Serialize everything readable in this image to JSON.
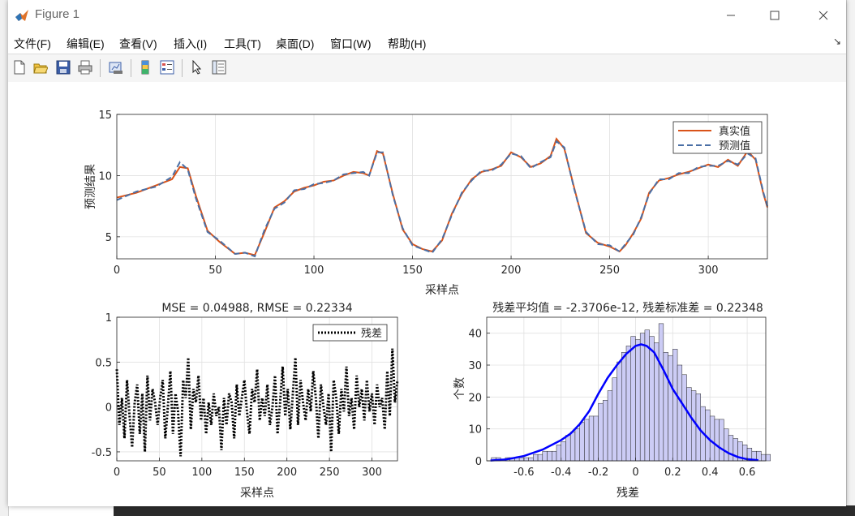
{
  "window": {
    "title": "Figure 1"
  },
  "menu": [
    "文件(F)",
    "编辑(E)",
    "查看(V)",
    "插入(I)",
    "工具(T)",
    "桌面(D)",
    "窗口(W)",
    "帮助(H)"
  ],
  "toolbar_icons": [
    "new-figure-icon",
    "open-file-icon",
    "save-icon",
    "print-icon",
    "link-plot-icon",
    "insert-colorbar-icon",
    "insert-legend-icon",
    "edit-plot-cursor-icon",
    "property-inspector-icon"
  ],
  "colors": {
    "actual": "#d95319",
    "predicted": "#4a6fa5",
    "residual": "#000000",
    "hist_fill": "#ccccf5",
    "kde": "#0000ff",
    "grid": "#e1e1e1"
  },
  "chart_data": [
    {
      "type": "line",
      "ylabel": "预测结果",
      "xlabel": "采样点",
      "xlim": [
        0,
        330
      ],
      "ylim": [
        3.2,
        15
      ],
      "xticks": [
        0,
        50,
        100,
        150,
        200,
        250,
        300
      ],
      "yticks": [
        5,
        10,
        15
      ],
      "grid": true,
      "legend_position": "top-right",
      "legend": [
        "真实值",
        "预测值"
      ],
      "series": [
        {
          "name": "真实值",
          "style": "solid"
        },
        {
          "name": "预测值",
          "style": "dashed"
        }
      ],
      "x": [
        0,
        10,
        20,
        28,
        32,
        36,
        40,
        46,
        52,
        60,
        65,
        70,
        75,
        80,
        85,
        90,
        95,
        100,
        105,
        110,
        115,
        120,
        125,
        128,
        132,
        135,
        140,
        145,
        150,
        155,
        160,
        165,
        170,
        175,
        180,
        185,
        190,
        195,
        200,
        205,
        210,
        215,
        220,
        223,
        227,
        232,
        238,
        244,
        250,
        255,
        258,
        262,
        266,
        270,
        275,
        280,
        285,
        290,
        295,
        300,
        305,
        310,
        315,
        320,
        324,
        328,
        330
      ],
      "values_actual": [
        8.2,
        8.6,
        9.2,
        9.7,
        10.7,
        10.6,
        8.4,
        5.5,
        4.6,
        3.6,
        3.7,
        3.5,
        5.4,
        7.4,
        7.9,
        8.7,
        9.0,
        9.2,
        9.5,
        9.6,
        10.0,
        10.3,
        10.2,
        10.0,
        12.0,
        11.8,
        8.5,
        5.6,
        4.4,
        4.0,
        3.8,
        4.7,
        6.9,
        8.5,
        9.7,
        10.3,
        10.5,
        10.8,
        11.9,
        11.5,
        10.7,
        11.0,
        11.6,
        13.0,
        12.2,
        9.0,
        5.3,
        4.5,
        4.2,
        3.8,
        4.3,
        5.3,
        6.5,
        8.6,
        9.6,
        9.8,
        10.1,
        10.3,
        10.6,
        10.9,
        10.7,
        11.3,
        10.8,
        12.0,
        11.3,
        8.5,
        7.4
      ],
      "values_predicted": [
        8.0,
        8.7,
        9.1,
        9.9,
        11.1,
        10.5,
        8.2,
        5.4,
        4.7,
        3.6,
        3.7,
        3.4,
        5.6,
        7.3,
        7.8,
        8.8,
        8.9,
        9.3,
        9.4,
        9.6,
        10.1,
        10.2,
        10.3,
        10.0,
        11.9,
        11.9,
        8.4,
        5.7,
        4.3,
        4.0,
        3.7,
        4.8,
        6.8,
        8.6,
        9.6,
        10.4,
        10.4,
        10.9,
        11.8,
        11.6,
        10.6,
        11.1,
        11.5,
        12.8,
        12.3,
        8.9,
        5.4,
        4.4,
        4.3,
        3.8,
        4.4,
        5.2,
        6.6,
        8.5,
        9.7,
        9.7,
        10.2,
        10.2,
        10.7,
        10.8,
        10.8,
        11.2,
        10.9,
        11.8,
        11.4,
        8.6,
        7.5
      ]
    },
    {
      "type": "line",
      "title": "MSE = 0.04988, RMSE = 0.22334",
      "xlabel": "采样点",
      "xlim": [
        0,
        330
      ],
      "ylim": [
        -0.6,
        1
      ],
      "xticks": [
        0,
        50,
        100,
        150,
        200,
        250,
        300
      ],
      "yticks": [
        -0.5,
        0,
        0.5,
        1
      ],
      "grid": true,
      "legend_position": "top-right",
      "series": [
        {
          "name": "残差",
          "style": "dotted"
        }
      ],
      "x": [
        0,
        3,
        6,
        9,
        12,
        15,
        18,
        21,
        24,
        27,
        30,
        33,
        36,
        39,
        42,
        45,
        48,
        51,
        54,
        57,
        60,
        63,
        66,
        69,
        72,
        75,
        78,
        81,
        84,
        87,
        90,
        93,
        96,
        99,
        102,
        105,
        108,
        111,
        114,
        117,
        120,
        123,
        126,
        129,
        132,
        135,
        138,
        141,
        144,
        147,
        150,
        153,
        156,
        159,
        162,
        165,
        168,
        171,
        174,
        177,
        180,
        183,
        186,
        189,
        192,
        195,
        198,
        201,
        204,
        207,
        210,
        213,
        216,
        219,
        222,
        225,
        228,
        231,
        234,
        237,
        240,
        243,
        246,
        249,
        252,
        255,
        258,
        261,
        264,
        267,
        270,
        273,
        276,
        279,
        282,
        285,
        288,
        291,
        294,
        297,
        300,
        303,
        306,
        309,
        312,
        315,
        318,
        321,
        324,
        327,
        330
      ],
      "values": [
        0.42,
        -0.2,
        0.1,
        -0.35,
        0.3,
        -0.1,
        -0.45,
        0.05,
        0.25,
        -0.3,
        0.15,
        -0.5,
        0.35,
        -0.15,
        0.2,
        0.05,
        -0.2,
        0.1,
        0.3,
        -0.35,
        0.0,
        0.4,
        -0.3,
        0.15,
        -0.05,
        -0.55,
        0.3,
        0.1,
        0.55,
        -0.25,
        0.2,
        0.05,
        0.35,
        -0.15,
        0.1,
        -0.3,
        0.05,
        -0.2,
        0.15,
        -0.1,
        0.0,
        -0.48,
        0.1,
        -0.2,
        0.15,
        0.05,
        -0.35,
        0.25,
        -0.1,
        0.1,
        0.3,
        -0.05,
        -0.3,
        0.2,
        0.05,
        0.42,
        -0.15,
        0.1,
        -0.1,
        0.25,
        -0.2,
        0.0,
        0.35,
        -0.3,
        0.05,
        0.45,
        -0.1,
        0.2,
        -0.25,
        0.15,
        0.55,
        -0.2,
        0.3,
        0.05,
        -0.15,
        0.2,
        -0.05,
        0.4,
        0.1,
        -0.35,
        0.25,
        0.0,
        -0.2,
        0.15,
        -0.5,
        0.3,
        0.1,
        -0.3,
        0.2,
        -0.05,
        0.45,
        -0.1,
        0.1,
        -0.25,
        0.35,
        0.0,
        0.2,
        -0.15,
        0.3,
        -0.05,
        0.15,
        -0.2,
        0.25,
        0.0,
        0.1,
        -0.25,
        0.4,
        -0.1,
        0.65,
        0.05,
        0.3
      ]
    },
    {
      "type": "bar",
      "title": "残差平均值 = -2.3706e-12, 残差标准差 = 0.22348",
      "xlabel": "残差",
      "ylabel": "个数",
      "xlim": [
        -0.8,
        0.7
      ],
      "ylim": [
        0,
        45
      ],
      "xticks": [
        -0.6,
        -0.4,
        -0.2,
        0,
        0.2,
        0.4,
        0.6
      ],
      "yticks": [
        0,
        10,
        20,
        30,
        40
      ],
      "grid": true,
      "bin_start": -0.775,
      "bin_width": 0.025,
      "values": [
        1,
        1,
        0,
        1,
        1,
        1,
        1,
        1,
        1,
        2,
        2,
        3,
        3,
        3,
        5,
        6,
        8,
        9,
        10,
        12,
        13,
        14,
        14,
        18,
        19,
        22,
        26,
        31,
        34,
        36,
        39,
        38,
        40,
        41,
        39,
        37,
        43,
        34,
        33,
        35,
        30,
        27,
        23,
        22,
        21,
        17,
        16,
        14,
        13,
        13,
        10,
        8,
        7,
        6,
        5,
        4,
        3,
        3,
        2,
        2,
        1
      ],
      "kde_x": [
        -0.78,
        -0.7,
        -0.6,
        -0.5,
        -0.4,
        -0.35,
        -0.3,
        -0.25,
        -0.2,
        -0.15,
        -0.1,
        -0.05,
        0.0,
        0.03,
        0.06,
        0.1,
        0.15,
        0.2,
        0.25,
        0.3,
        0.35,
        0.4,
        0.45,
        0.5,
        0.55,
        0.6,
        0.66
      ],
      "kde_y": [
        0.1,
        0.4,
        1.5,
        3.5,
        6.5,
        8.5,
        11.5,
        15.5,
        21,
        26,
        30,
        33.5,
        36,
        36.5,
        36,
        34,
        28.5,
        22.5,
        18,
        13.5,
        9.5,
        6.5,
        4.2,
        2.4,
        1.2,
        0.5,
        0.2
      ]
    }
  ]
}
